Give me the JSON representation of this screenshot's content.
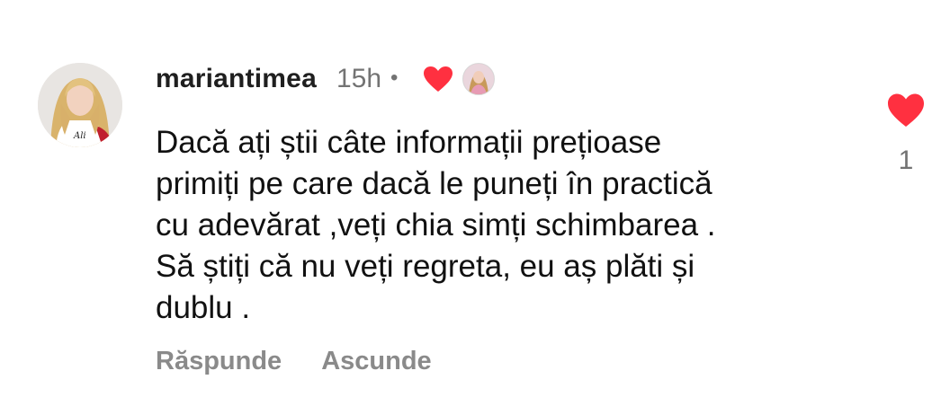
{
  "comment": {
    "username": "mariantimea",
    "timestamp": "15h",
    "separator": "•",
    "text": "Dacă ați știi câte informații prețioase\nprimiți pe care dacă le puneți în practică\ncu adevărat ,veți chia simți schimbarea .\nSă știți că nu veți regreta, eu aș plăti și\ndublu .",
    "actions": {
      "reply_label": "Răspunde",
      "hide_label": "Ascunde"
    },
    "like_count": "1",
    "liked_by_creator": true
  },
  "icons": {
    "creator_like": "heart-icon",
    "like": "heart-icon"
  },
  "colors": {
    "heart": "#ff3040",
    "secondary_text": "#737373",
    "action_text": "#8a8a8a"
  }
}
